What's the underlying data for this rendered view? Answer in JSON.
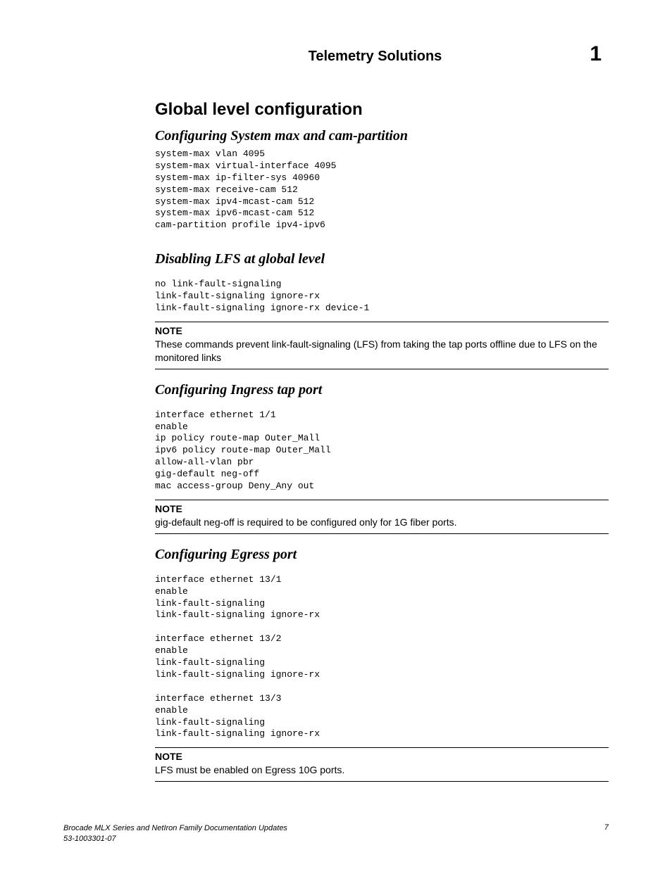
{
  "header": {
    "running_title": "Telemetry Solutions",
    "chapter_number": "1"
  },
  "sections": {
    "global_level": {
      "title": "Global level configuration"
    },
    "system_max": {
      "title": "Configuring System max and cam-partition",
      "code": "system-max vlan 4095\nsystem-max virtual-interface 4095\nsystem-max ip-filter-sys 40960\nsystem-max receive-cam 512\nsystem-max ipv4-mcast-cam 512\nsystem-max ipv6-mcast-cam 512\ncam-partition profile ipv4-ipv6"
    },
    "disabling_lfs": {
      "title": "Disabling LFS at global level",
      "code": "no link-fault-signaling\nlink-fault-signaling ignore-rx\nlink-fault-signaling ignore-rx device-1",
      "note_label": "NOTE",
      "note_text": "These commands prevent link-fault-signaling (LFS) from taking the tap ports offline due to LFS on the monitored links"
    },
    "ingress_tap": {
      "title": "Configuring Ingress tap port",
      "code": "interface ethernet 1/1\nenable\nip policy route-map Outer_Mall\nipv6 policy route-map Outer_Mall\nallow-all-vlan pbr\ngig-default neg-off\nmac access-group Deny_Any out",
      "note_label": "NOTE",
      "note_text": "gig-default neg-off is required to be configured only for 1G fiber ports."
    },
    "egress": {
      "title": "Configuring Egress port",
      "code": "interface ethernet 13/1\nenable\nlink-fault-signaling\nlink-fault-signaling ignore-rx\n\ninterface ethernet 13/2\nenable\nlink-fault-signaling\nlink-fault-signaling ignore-rx\n\ninterface ethernet 13/3\nenable\nlink-fault-signaling\nlink-fault-signaling ignore-rx",
      "note_label": "NOTE",
      "note_text": "LFS must be enabled on Egress 10G ports."
    }
  },
  "footer": {
    "doc_title": "Brocade MLX Series and NetIron Family Documentation Updates",
    "doc_id": "53-1003301-07",
    "page_number": "7"
  }
}
